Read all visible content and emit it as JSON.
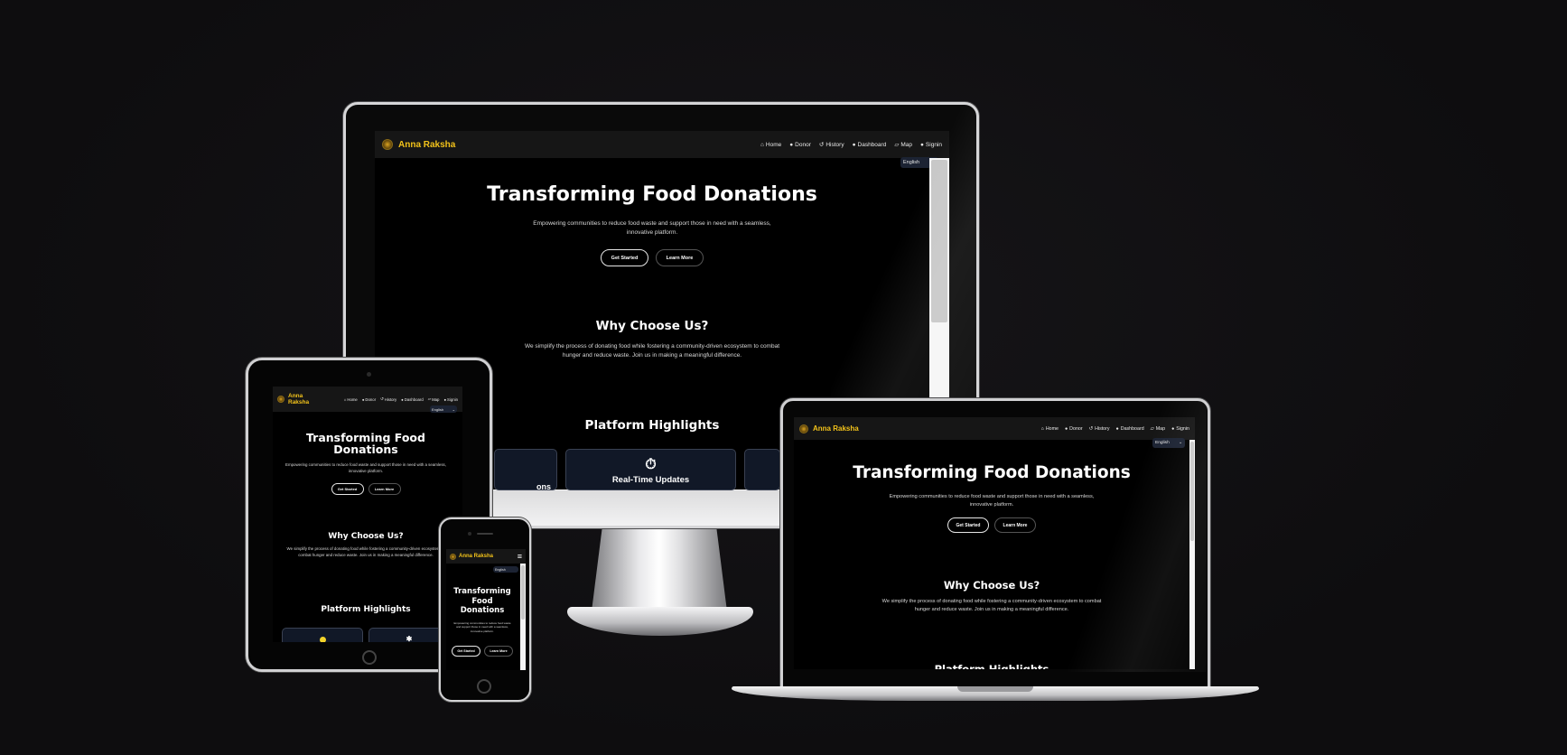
{
  "site": {
    "brand": "Anna Raksha",
    "brand_short_1": "Anna",
    "brand_short_2": "Raksha",
    "nav": [
      {
        "icon": "home-icon",
        "glyph": "⌂",
        "label": "Home"
      },
      {
        "icon": "user-icon",
        "glyph": "●",
        "label": "Donor"
      },
      {
        "icon": "history-icon",
        "glyph": "↺",
        "label": "History"
      },
      {
        "icon": "dashboard-icon",
        "glyph": "●",
        "label": "Dashboard"
      },
      {
        "icon": "map-icon",
        "glyph": "▱",
        "label": "Map"
      },
      {
        "icon": "signin-icon",
        "glyph": "●",
        "label": "Signin"
      }
    ],
    "language": "English",
    "hero": {
      "title": "Transforming Food Donations",
      "title_line1": "Transforming Food",
      "title_line2": "Donations",
      "phone_title_1": "Transforming",
      "phone_title_2": "Food",
      "phone_title_3": "Donations",
      "subtitle": "Empowering communities to reduce food waste and support those in need with a seamless, innovative platform.",
      "get_started": "Get Started",
      "learn_more": "Learn More"
    },
    "why": {
      "title": "Why Choose Us?",
      "text": "We simplify the process of donating food while fostering a community-driven ecosystem to combat hunger and reduce waste. Join us in making a meaningful difference."
    },
    "highlights": {
      "title": "Platform Highlights",
      "card_left_partial": "ons",
      "card_center": "Real-Time Updates"
    }
  }
}
